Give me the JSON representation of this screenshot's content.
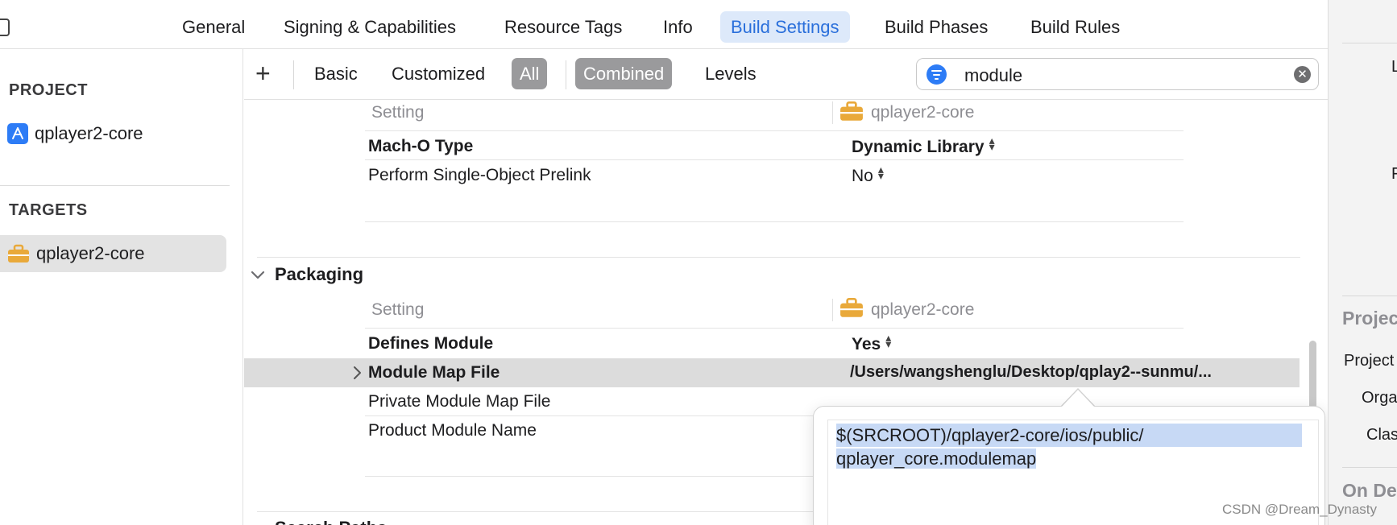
{
  "tabs": [
    "General",
    "Signing & Capabilities",
    "Resource Tags",
    "Info",
    "Build Settings",
    "Build Phases",
    "Build Rules"
  ],
  "active_tab": "Build Settings",
  "sidebar": {
    "project_heading": "PROJECT",
    "project_item": "qplayer2-core",
    "targets_heading": "TARGETS",
    "target_item": "qplayer2-core"
  },
  "filter": {
    "add_label": "+",
    "basic": "Basic",
    "customized": "Customized",
    "all": "All",
    "combined": "Combined",
    "levels": "Levels",
    "search_value": "module"
  },
  "settings": {
    "column_setting": "Setting",
    "column_target": "qplayer2-core",
    "linking_rows": [
      {
        "name": "Mach-O Type",
        "value": "Dynamic Library"
      },
      {
        "name": "Perform Single-Object Prelink",
        "value": "No"
      }
    ],
    "packaging": {
      "title": "Packaging",
      "column_setting": "Setting",
      "column_target": "qplayer2-core",
      "rows": [
        {
          "name": "Defines Module",
          "value": "Yes"
        },
        {
          "name": "Module Map File",
          "value": "/Users/wangshenglu/Desktop/qplay2--sunmu/..."
        },
        {
          "name": "Private Module Map File",
          "value": ""
        },
        {
          "name": "Product Module Name",
          "value": ""
        }
      ]
    },
    "next_section_partial": "Search Paths"
  },
  "popover": {
    "line1": "$(SRCROOT)/qplayer2-core/ios/public/",
    "line2": "qplayer_core.modulemap"
  },
  "inspector": {
    "labels": [
      "L",
      "F",
      "Projec",
      "Project",
      "Orga",
      "Clas",
      "On De"
    ]
  },
  "watermark": "CSDN @Dream_Dynasty",
  "colors": {
    "accent": "#2a6fdb",
    "tab_active_bg": "#dde9fa",
    "selected_pill": "#9a9a9c",
    "text_selection": "#c7d9f5",
    "toolbox_icon": "#e9a93a"
  }
}
